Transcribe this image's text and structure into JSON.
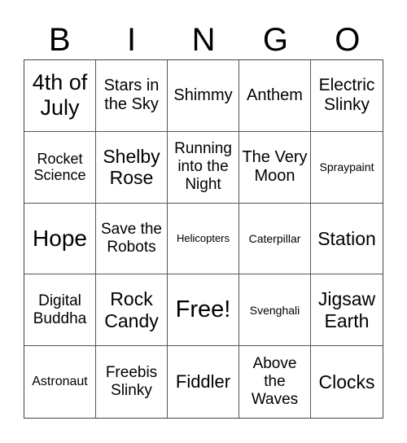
{
  "header": {
    "letters": [
      "B",
      "I",
      "N",
      "G",
      "O"
    ]
  },
  "cells": [
    {
      "text": "4th of July",
      "size": 27
    },
    {
      "text": "Stars in the Sky",
      "size": 20
    },
    {
      "text": "Shimmy",
      "size": 20
    },
    {
      "text": "Anthem",
      "size": 20
    },
    {
      "text": "Electric Slinky",
      "size": 21
    },
    {
      "text": "Rocket Science",
      "size": 18
    },
    {
      "text": "Shelby Rose",
      "size": 23
    },
    {
      "text": "Running into the Night",
      "size": 19
    },
    {
      "text": "The Very Moon",
      "size": 20
    },
    {
      "text": "Spraypaint",
      "size": 14
    },
    {
      "text": "Hope",
      "size": 28
    },
    {
      "text": "Save the Robots",
      "size": 19
    },
    {
      "text": "Helicopters",
      "size": 13
    },
    {
      "text": "Caterpillar",
      "size": 14
    },
    {
      "text": "Station",
      "size": 23
    },
    {
      "text": "Digital Buddha",
      "size": 19
    },
    {
      "text": "Rock Candy",
      "size": 23
    },
    {
      "text": "Free!",
      "size": 29
    },
    {
      "text": "Svenghali",
      "size": 14
    },
    {
      "text": "Jigsaw Earth",
      "size": 23
    },
    {
      "text": "Astronaut",
      "size": 16
    },
    {
      "text": "Freebis Slinky",
      "size": 19
    },
    {
      "text": "Fiddler",
      "size": 22
    },
    {
      "text": "Above the Waves",
      "size": 19
    },
    {
      "text": "Clocks",
      "size": 23
    }
  ]
}
